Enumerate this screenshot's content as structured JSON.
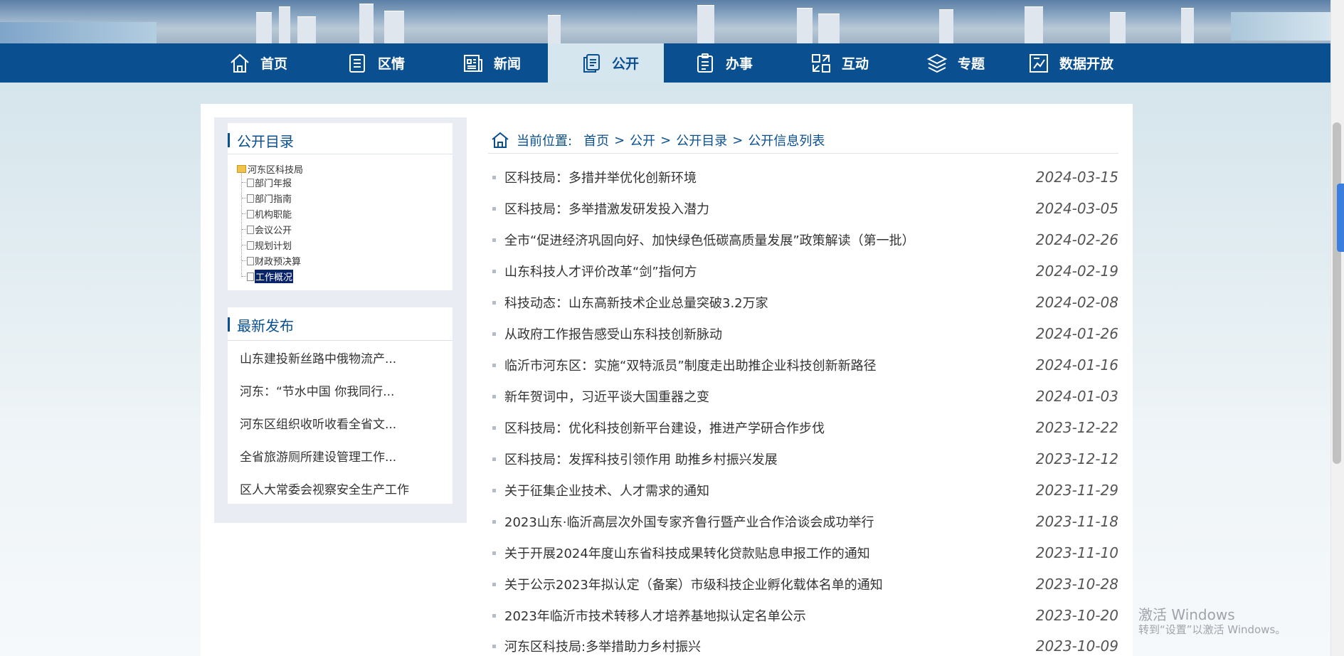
{
  "nav": {
    "items": [
      {
        "label": "首页",
        "icon": "home-icon"
      },
      {
        "label": "区情",
        "icon": "document-list-icon"
      },
      {
        "label": "新闻",
        "icon": "newspaper-icon"
      },
      {
        "label": "公开",
        "icon": "copy-document-icon",
        "active": true
      },
      {
        "label": "办事",
        "icon": "clipboard-icon"
      },
      {
        "label": "互动",
        "icon": "interaction-icon"
      },
      {
        "label": "专题",
        "icon": "layers-icon"
      },
      {
        "label": "数据开放",
        "icon": "chart-icon"
      }
    ]
  },
  "sidebar": {
    "catalog_title": "公开目录",
    "tree_root": "河东区科技局",
    "tree_items": [
      "部门年报",
      "部门指南",
      "机构职能",
      "会议公开",
      "规划计划",
      "财政预决算",
      "工作概况"
    ],
    "selected_item": "工作概况",
    "latest_title": "最新发布",
    "latest_items": [
      "山东建投新丝路中俄物流产...",
      "河东：“节水中国 你我同行...",
      "河东区组织收听收看全省文...",
      "全省旅游厕所建设管理工作...",
      "区人大常委会视察安全生产工作"
    ]
  },
  "breadcrumb": {
    "prefix": "当前位置:",
    "items": [
      "首页",
      "公开",
      "公开目录",
      "公开信息列表"
    ],
    "separator": ">"
  },
  "list": [
    {
      "title": "区科技局：多措并举优化创新环境",
      "date": "2024-03-15"
    },
    {
      "title": "区科技局：多举措激发研发投入潜力",
      "date": "2024-03-05"
    },
    {
      "title": "全市“促进经济巩固向好、加快绿色低碳高质量发展”政策解读（第一批）",
      "date": "2024-02-26"
    },
    {
      "title": "山东科技人才评价改革“剑”指何方",
      "date": "2024-02-19"
    },
    {
      "title": "科技动态：山东高新技术企业总量突破3.2万家",
      "date": "2024-02-08"
    },
    {
      "title": "从政府工作报告感受山东科技创新脉动",
      "date": "2024-01-26"
    },
    {
      "title": "临沂市河东区：实施“双特派员”制度走出助推企业科技创新新路径",
      "date": "2024-01-16"
    },
    {
      "title": "新年贺词中，习近平谈大国重器之变",
      "date": "2024-01-03"
    },
    {
      "title": "区科技局：优化科技创新平台建设，推进产学研合作步伐",
      "date": "2023-12-22"
    },
    {
      "title": "区科技局：发挥科技引领作用 助推乡村振兴发展",
      "date": "2023-12-12"
    },
    {
      "title": "关于征集企业技术、人才需求的通知",
      "date": "2023-11-29"
    },
    {
      "title": "2023山东·临沂高层次外国专家齐鲁行暨产业合作洽谈会成功举行",
      "date": "2023-11-18"
    },
    {
      "title": "关于开展2024年度山东省科技成果转化贷款贴息申报工作的通知",
      "date": "2023-11-10"
    },
    {
      "title": "关于公示2023年拟认定（备案）市级科技企业孵化载体名单的通知",
      "date": "2023-10-28"
    },
    {
      "title": "2023年临沂市技术转移人才培养基地拟认定名单公示",
      "date": "2023-10-20"
    },
    {
      "title": "河东区科技局:多举措助力乡村振兴",
      "date": "2023-10-09"
    }
  ],
  "watermark": {
    "line1": "激活 Windows",
    "line2": "转到“设置”以激活 Windows。"
  },
  "colors": {
    "nav_bg": "#0a4f8f",
    "nav_active_bg": "#d6e6ee",
    "accent": "#0a4f8f"
  }
}
